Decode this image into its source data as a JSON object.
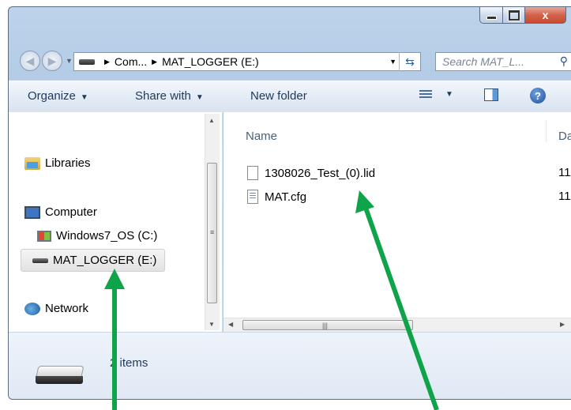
{
  "window": {
    "caption_buttons": {
      "minimize": "minimize-icon",
      "maximize": "maximize-icon",
      "close": "x"
    }
  },
  "navigation": {
    "address_crumbs": [
      "Com...",
      "MAT_LOGGER (E:)"
    ],
    "search_placeholder": "Search MAT_L..."
  },
  "toolbar": {
    "organize_label": "Organize",
    "share_label": "Share with",
    "new_folder_label": "New folder"
  },
  "sidebar": {
    "items": [
      {
        "label": "Libraries",
        "icon": "libraries-icon"
      },
      {
        "label": "Computer",
        "icon": "computer-icon"
      },
      {
        "label": "Windows7_OS (C:)",
        "icon": "windows-drive-icon"
      },
      {
        "label": "MAT_LOGGER (E:)",
        "icon": "usb-drive-icon",
        "selected": true
      },
      {
        "label": "Network",
        "icon": "network-icon"
      }
    ]
  },
  "content": {
    "columns": [
      "Name",
      "Da"
    ],
    "files": [
      {
        "name": "1308026_Test_(0).lid",
        "date": "11/"
      },
      {
        "name": "MAT.cfg",
        "date": "11/"
      }
    ]
  },
  "details": {
    "count_text": "2 items"
  },
  "colors": {
    "annotation_arrow": "#0fa34a"
  }
}
